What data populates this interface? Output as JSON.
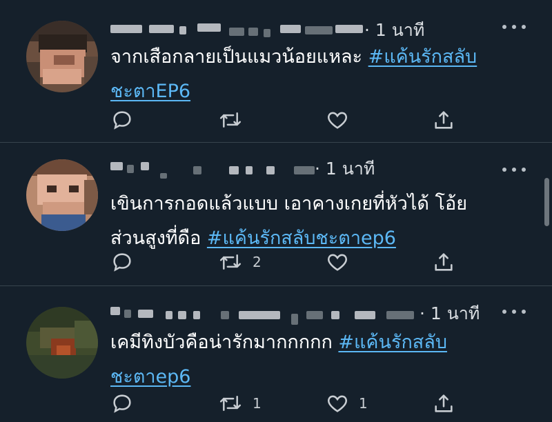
{
  "colors": {
    "background": "#15202b",
    "divider": "#38444d",
    "text": "#ffffff",
    "hashtag": "#5cb8f5",
    "meta": "#d9dde1",
    "icon": "#c8cdd2"
  },
  "tweets": [
    {
      "time": "· 1 นาที",
      "text_plain": "จากเสือกลายเป็นแมวน้อยแหละ ",
      "text_line2_plain": "",
      "hashtag_line1": "#แค้นรักสลับ",
      "hashtag_line2": "ชะตาEP6",
      "reply_count": "",
      "retweet_count": "",
      "like_count": ""
    },
    {
      "time": "· 1 นาที",
      "text_plain": "เขินการกอดแล้วแบบ เอาคางเกยที่หัวได้ โอ้ย",
      "text_line2_plain": "ส่วนสูงที่ดือ ",
      "hashtag_line1": "",
      "hashtag_line2": "#แค้นรักสลับชะตาep6",
      "reply_count": "",
      "retweet_count": "2",
      "like_count": ""
    },
    {
      "time": "· 1 นาที",
      "text_plain": "เคมีทิงบัวคือน่ารักมากกกกก ",
      "text_line2_plain": "",
      "hashtag_line1": "#แค้นรักสลับ",
      "hashtag_line2": "ชะตาep6",
      "reply_count": "",
      "retweet_count": "1",
      "like_count": "1"
    }
  ],
  "icons": {
    "reply": "reply-icon",
    "retweet": "retweet-icon",
    "like": "heart-icon",
    "share": "share-icon",
    "more": "more-icon"
  }
}
